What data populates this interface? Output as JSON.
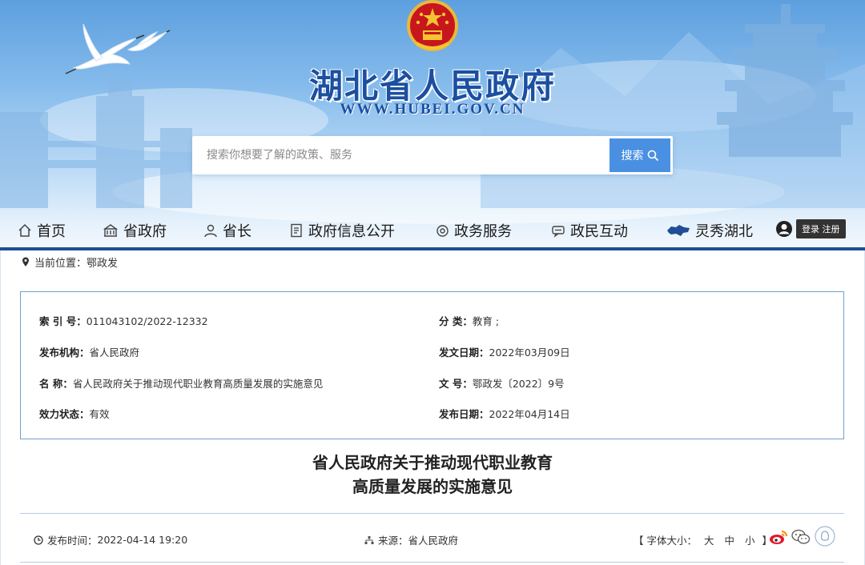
{
  "header": {
    "site_title": "湖北省人民政府",
    "site_url": "WWW.HUBEI.GOV.CN"
  },
  "search": {
    "placeholder": "搜索你想要了解的政策、服务",
    "button_label": "搜索"
  },
  "nav": {
    "items": [
      {
        "label": "首页",
        "icon": "home-icon"
      },
      {
        "label": "省政府",
        "icon": "building-icon"
      },
      {
        "label": "省长",
        "icon": "person-icon"
      },
      {
        "label": "政府信息公开",
        "icon": "document-icon"
      },
      {
        "label": "政务服务",
        "icon": "service-icon"
      },
      {
        "label": "政民互动",
        "icon": "chat-icon"
      },
      {
        "label": "灵秀湖北",
        "icon": "hubei-map-icon"
      }
    ],
    "login_label": "登录 注册"
  },
  "breadcrumb": {
    "label": "当前位置：",
    "current": "鄂政发"
  },
  "info": {
    "index_label": "索 引 号：",
    "index_value": "011043102/2022-12332",
    "category_label": "分 类：",
    "category_value": "教育 ;",
    "publisher_label": "发布机构：",
    "publisher_value": "省人民政府",
    "issue_date_label": "发文日期：",
    "issue_date_value": "2022年03月09日",
    "name_label": "名 称：",
    "name_value": "省人民政府关于推动现代职业教育高质量发展的实施意见",
    "doc_no_label": "文 号：",
    "doc_no_value": "鄂政发〔2022〕9号",
    "status_label": "效力状态：",
    "status_value": "有效",
    "publish_date_label": "发布日期：",
    "publish_date_value": "2022年04月14日"
  },
  "document": {
    "title_line1": "省人民政府关于推动现代职业教育",
    "title_line2": "高质量发展的实施意见"
  },
  "meta": {
    "publish_time_label": "发布时间：",
    "publish_time_value": "2022-04-14 19:20",
    "source_label": "来源：",
    "source_value": "省人民政府",
    "font_size_open": "【 字体大小：",
    "font_large": "大",
    "font_medium": "中",
    "font_small": "小",
    "font_size_close": "】"
  },
  "colors": {
    "brand_blue": "#1b4fa0",
    "nav_bar": "#1f4e96",
    "search_button": "#4a90e2",
    "info_border": "#6f9fd2"
  }
}
